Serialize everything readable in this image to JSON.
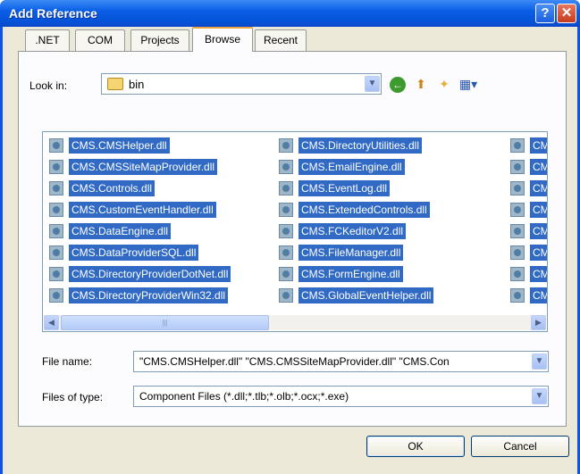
{
  "window": {
    "title": "Add Reference",
    "help_label": "?",
    "close_label": "✕"
  },
  "tabs": [
    {
      "label": ".NET"
    },
    {
      "label": "COM"
    },
    {
      "label": "Projects"
    },
    {
      "label": "Browse",
      "active": true
    },
    {
      "label": "Recent"
    }
  ],
  "look_in": {
    "label": "Look in:",
    "value": "bin"
  },
  "files": [
    {
      "name": "CMS.CMSHelper.dll"
    },
    {
      "name": "CMS.CMSSiteMapProvider.dll"
    },
    {
      "name": "CMS.Controls.dll"
    },
    {
      "name": "CMS.CustomEventHandler.dll"
    },
    {
      "name": "CMS.DataEngine.dll"
    },
    {
      "name": "CMS.DataProviderSQL.dll"
    },
    {
      "name": "CMS.DirectoryProviderDotNet.dll"
    },
    {
      "name": "CMS.DirectoryProviderWin32.dll"
    },
    {
      "name": "CMS.DirectoryUtilities.dll"
    },
    {
      "name": "CMS.EmailEngine.dll"
    },
    {
      "name": "CMS.EventLog.dll"
    },
    {
      "name": "CMS.ExtendedControls.dll"
    },
    {
      "name": "CMS.FCKeditorV2.dll"
    },
    {
      "name": "CMS.FileManager.dll"
    },
    {
      "name": "CMS.FormEngine.dll"
    },
    {
      "name": "CMS.GlobalEventHelper.dll"
    },
    {
      "name": "CMS"
    },
    {
      "name": "CMS"
    },
    {
      "name": "CMS"
    },
    {
      "name": "CMS"
    },
    {
      "name": "CMS"
    },
    {
      "name": "CMS"
    },
    {
      "name": "CMS"
    },
    {
      "name": "CMS"
    }
  ],
  "file_name": {
    "label": "File name:",
    "value": "\"CMS.CMSHelper.dll\" \"CMS.CMSSiteMapProvider.dll\" \"CMS.Con"
  },
  "file_type": {
    "label": "Files of type:",
    "value": "Component Files (*.dll;*.tlb;*.olb;*.ocx;*.exe)"
  },
  "buttons": {
    "ok": "OK",
    "cancel": "Cancel"
  },
  "icons": [
    "folder-icon",
    "back-icon",
    "up-folder-icon",
    "new-folder-icon",
    "views-menu-icon",
    "dll-file-icon"
  ]
}
